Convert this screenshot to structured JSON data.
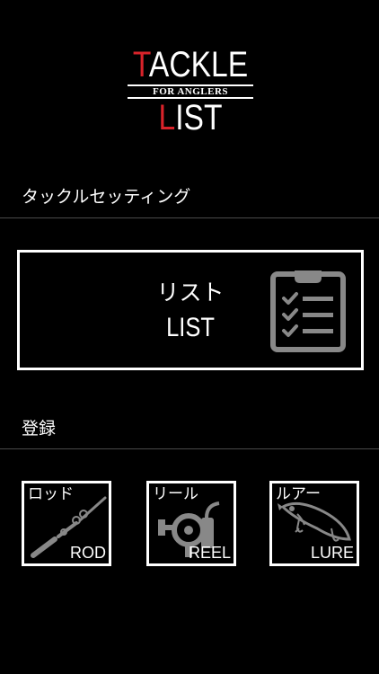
{
  "logo": {
    "top_first": "T",
    "top_rest": "ACKLE",
    "tagline": "FOR ANGLERS",
    "bottom_first": "L",
    "bottom_rest": "IST"
  },
  "tackle_setting": {
    "title": "タックルセッティング",
    "list_button": {
      "label_jp": "リスト",
      "label_en": "LIST",
      "icon": "clipboard-checklist-icon"
    }
  },
  "register": {
    "title": "登録",
    "items": [
      {
        "label_jp": "ロッド",
        "label_en": "ROD",
        "icon": "fishing-rod-icon"
      },
      {
        "label_jp": "リール",
        "label_en": "REEL",
        "icon": "fishing-reel-icon"
      },
      {
        "label_jp": "ルアー",
        "label_en": "LURE",
        "icon": "fishing-lure-icon"
      }
    ]
  },
  "colors": {
    "background": "#000000",
    "accent_red": "#d9232a",
    "icon_gray": "#888888",
    "divider": "#4a4a4a"
  }
}
